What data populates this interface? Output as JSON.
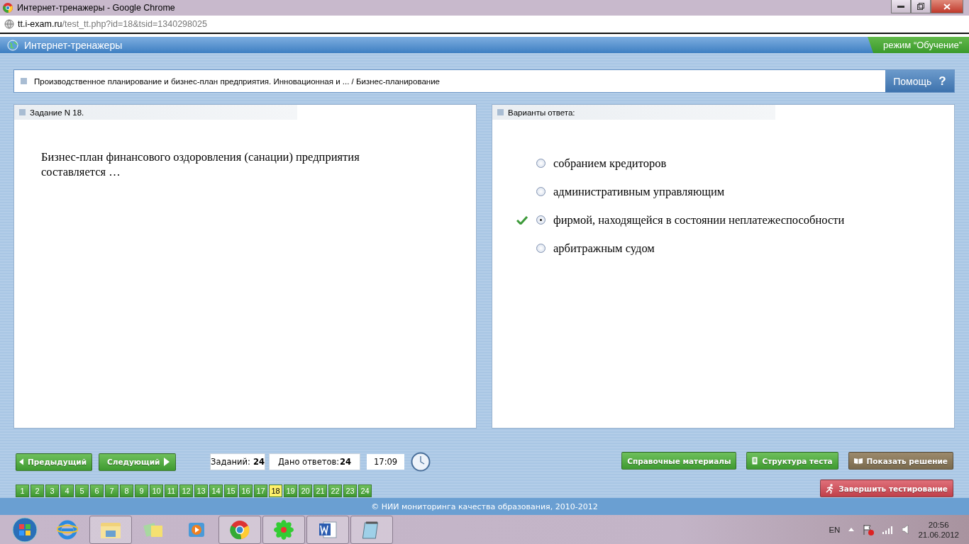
{
  "window": {
    "title": "Интернет-тренажеры - Google Chrome"
  },
  "address": {
    "host": "tt.i-exam.ru",
    "path": "/test_tt.php?id=18&tsid=1340298025"
  },
  "header": {
    "title": "Интернет-тренажеры",
    "mode": "режим “Обучение”"
  },
  "breadcrumb": {
    "text": "Производственное планирование и бизнес-план предприятия. Инновационная и ... / Бизнес-планирование",
    "help": "Помощь",
    "help_mark": "?"
  },
  "task": {
    "heading": "Задание N 18.",
    "question": "Бизнес-план финансового оздоровления (санации) предприятия составляется …"
  },
  "answers": {
    "heading": "Варианты ответа:",
    "options": [
      {
        "text": "собранием кредиторов",
        "selected": false,
        "correct": false
      },
      {
        "text": "административным управляющим",
        "selected": false,
        "correct": false
      },
      {
        "text": "фирмой, находящейся в состоянии неплатежеспособности",
        "selected": true,
        "correct": true
      },
      {
        "text": "арбитражным судом",
        "selected": false,
        "correct": false
      }
    ]
  },
  "nav": {
    "prev": "Предыдущий",
    "next": "Следующий",
    "tasks_label": "Заданий:",
    "tasks_count": "24",
    "answered_label": "Дано ответов:",
    "answered_count": "24",
    "time": "17:09"
  },
  "actions": [
    {
      "label": "Справочные материалы",
      "kind": "plain"
    },
    {
      "label": "Структура теста",
      "kind": "list"
    },
    {
      "label": "Показать решение",
      "kind": "solution"
    },
    {
      "label": "Завершить тестирование",
      "kind": "finish"
    }
  ],
  "pages": [
    {
      "label": "1",
      "selected": false
    },
    {
      "label": "2",
      "selected": false
    },
    {
      "label": "3",
      "selected": false
    },
    {
      "label": "4",
      "selected": false
    },
    {
      "label": "5",
      "selected": false
    },
    {
      "label": "6",
      "selected": false
    },
    {
      "label": "7",
      "selected": false
    },
    {
      "label": "8",
      "selected": false
    },
    {
      "label": "9",
      "selected": false
    },
    {
      "label": "10",
      "selected": false
    },
    {
      "label": "11",
      "selected": false
    },
    {
      "label": "12",
      "selected": false
    },
    {
      "label": "13",
      "selected": false
    },
    {
      "label": "14",
      "selected": false
    },
    {
      "label": "15",
      "selected": false
    },
    {
      "label": "16",
      "selected": false
    },
    {
      "label": "17",
      "selected": false
    },
    {
      "label": "18",
      "selected": true
    },
    {
      "label": "19",
      "selected": false
    },
    {
      "label": "20",
      "selected": false
    },
    {
      "label": "21",
      "selected": false
    },
    {
      "label": "22",
      "selected": false
    },
    {
      "label": "23",
      "selected": false
    },
    {
      "label": "24",
      "selected": false
    }
  ],
  "footer": "© НИИ мониторинга качества образования, 2010-2012",
  "taskbar": {
    "language": "EN",
    "time": "20:56",
    "date": "21.06.2012"
  }
}
